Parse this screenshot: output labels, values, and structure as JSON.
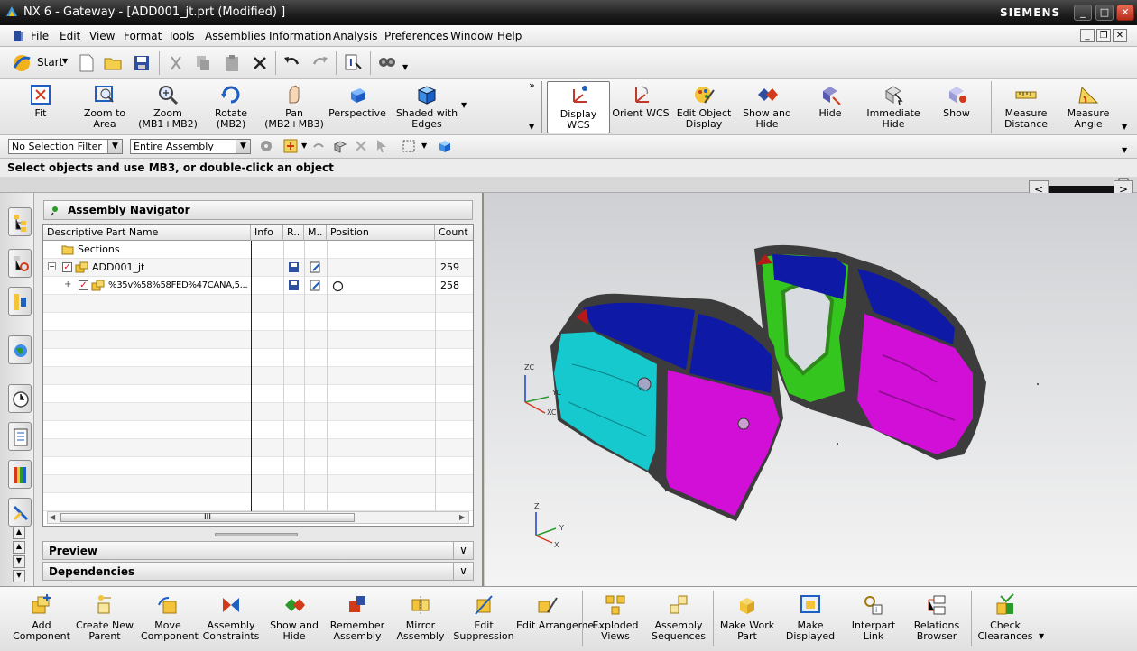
{
  "window": {
    "title": "NX 6 - Gateway - [ADD001_jt.prt (Modified) ]",
    "brand": "SIEMENS"
  },
  "menu": [
    "File",
    "Edit",
    "View",
    "Format",
    "Tools",
    "Assemblies",
    "Information",
    "Analysis",
    "Preferences",
    "Window",
    "Help"
  ],
  "standard": {
    "start_label": "Start"
  },
  "view_toolbar": [
    {
      "label": "Fit",
      "icon": "fit-icon"
    },
    {
      "label": "Zoom to Area",
      "icon": "zoom-area-icon"
    },
    {
      "label": "Zoom (MB1+MB2)",
      "icon": "zoom-icon"
    },
    {
      "label": "Rotate (MB2)",
      "icon": "rotate-icon"
    },
    {
      "label": "Pan (MB2+MB3)",
      "icon": "pan-icon"
    },
    {
      "label": "Perspective",
      "icon": "perspective-icon"
    },
    {
      "label": "Shaded with Edges",
      "icon": "shaded-icon"
    }
  ],
  "utility_toolbar": [
    {
      "label": "Display WCS",
      "icon": "wcs-icon"
    },
    {
      "label": "Orient WCS",
      "icon": "orient-wcs-icon"
    },
    {
      "label": "Edit Object Display",
      "icon": "edit-display-icon"
    },
    {
      "label": "Show and Hide",
      "icon": "show-hide-icon"
    },
    {
      "label": "Hide",
      "icon": "hide-icon"
    },
    {
      "label": "Immediate Hide",
      "icon": "immediate-hide-icon"
    },
    {
      "label": "Show",
      "icon": "show-icon"
    },
    {
      "label": "Measure Distance",
      "icon": "measure-distance-icon"
    },
    {
      "label": "Measure Angle",
      "icon": "measure-angle-icon"
    }
  ],
  "selection": {
    "filter": "No Selection Filter",
    "scope": "Entire Assembly"
  },
  "cue_line": "Select objects and use MB3, or double-click an object",
  "navigator": {
    "title": "Assembly Navigator",
    "columns": [
      "Descriptive Part Name",
      "Info",
      "R..",
      "M..",
      "Position",
      "Count"
    ],
    "rows": [
      {
        "name": "Sections",
        "count": ""
      },
      {
        "name": "ADD001_jt",
        "count": "259"
      },
      {
        "name": "%35v%58%58FED%47CANA,5...",
        "count": "258"
      }
    ],
    "scroll_thumb": "III",
    "preview": "Preview",
    "dependencies": "Dependencies"
  },
  "triad": {
    "zc": "ZC",
    "yc": "YC",
    "xc": "XC",
    "z": "Z",
    "y": "Y",
    "x": "X"
  },
  "assembly_toolbar": [
    {
      "label": "Add Component",
      "icon": "add-component-icon"
    },
    {
      "label": "Create New Parent",
      "icon": "new-parent-icon"
    },
    {
      "label": "Move Component",
      "icon": "move-component-icon"
    },
    {
      "label": "Assembly Constraints",
      "icon": "constraints-icon"
    },
    {
      "label": "Show and Hide",
      "icon": "show-hide-icon"
    },
    {
      "label": "Remember Assembly",
      "icon": "remember-icon"
    },
    {
      "label": "Mirror Assembly",
      "icon": "mirror-icon"
    },
    {
      "label": "Edit Suppression",
      "icon": "suppression-icon"
    },
    {
      "label": "Edit Arrangeme...",
      "icon": "arrangement-icon"
    },
    {
      "label": "Exploded Views",
      "icon": "exploded-icon"
    },
    {
      "label": "Assembly Sequences",
      "icon": "sequences-icon"
    },
    {
      "label": "Make Work Part",
      "icon": "work-part-icon"
    },
    {
      "label": "Make Displayed",
      "icon": "displayed-icon"
    },
    {
      "label": "Interpart Link",
      "icon": "link-icon"
    },
    {
      "label": "Relations Browser",
      "icon": "relations-icon"
    },
    {
      "label": "Check Clearances",
      "icon": "clearances-icon"
    }
  ],
  "colors": {
    "cyan": "#16c9cf",
    "magenta": "#d10fd6",
    "green": "#35c51f",
    "blue": "#0e1aa6",
    "frame": "#3c3c3c"
  }
}
